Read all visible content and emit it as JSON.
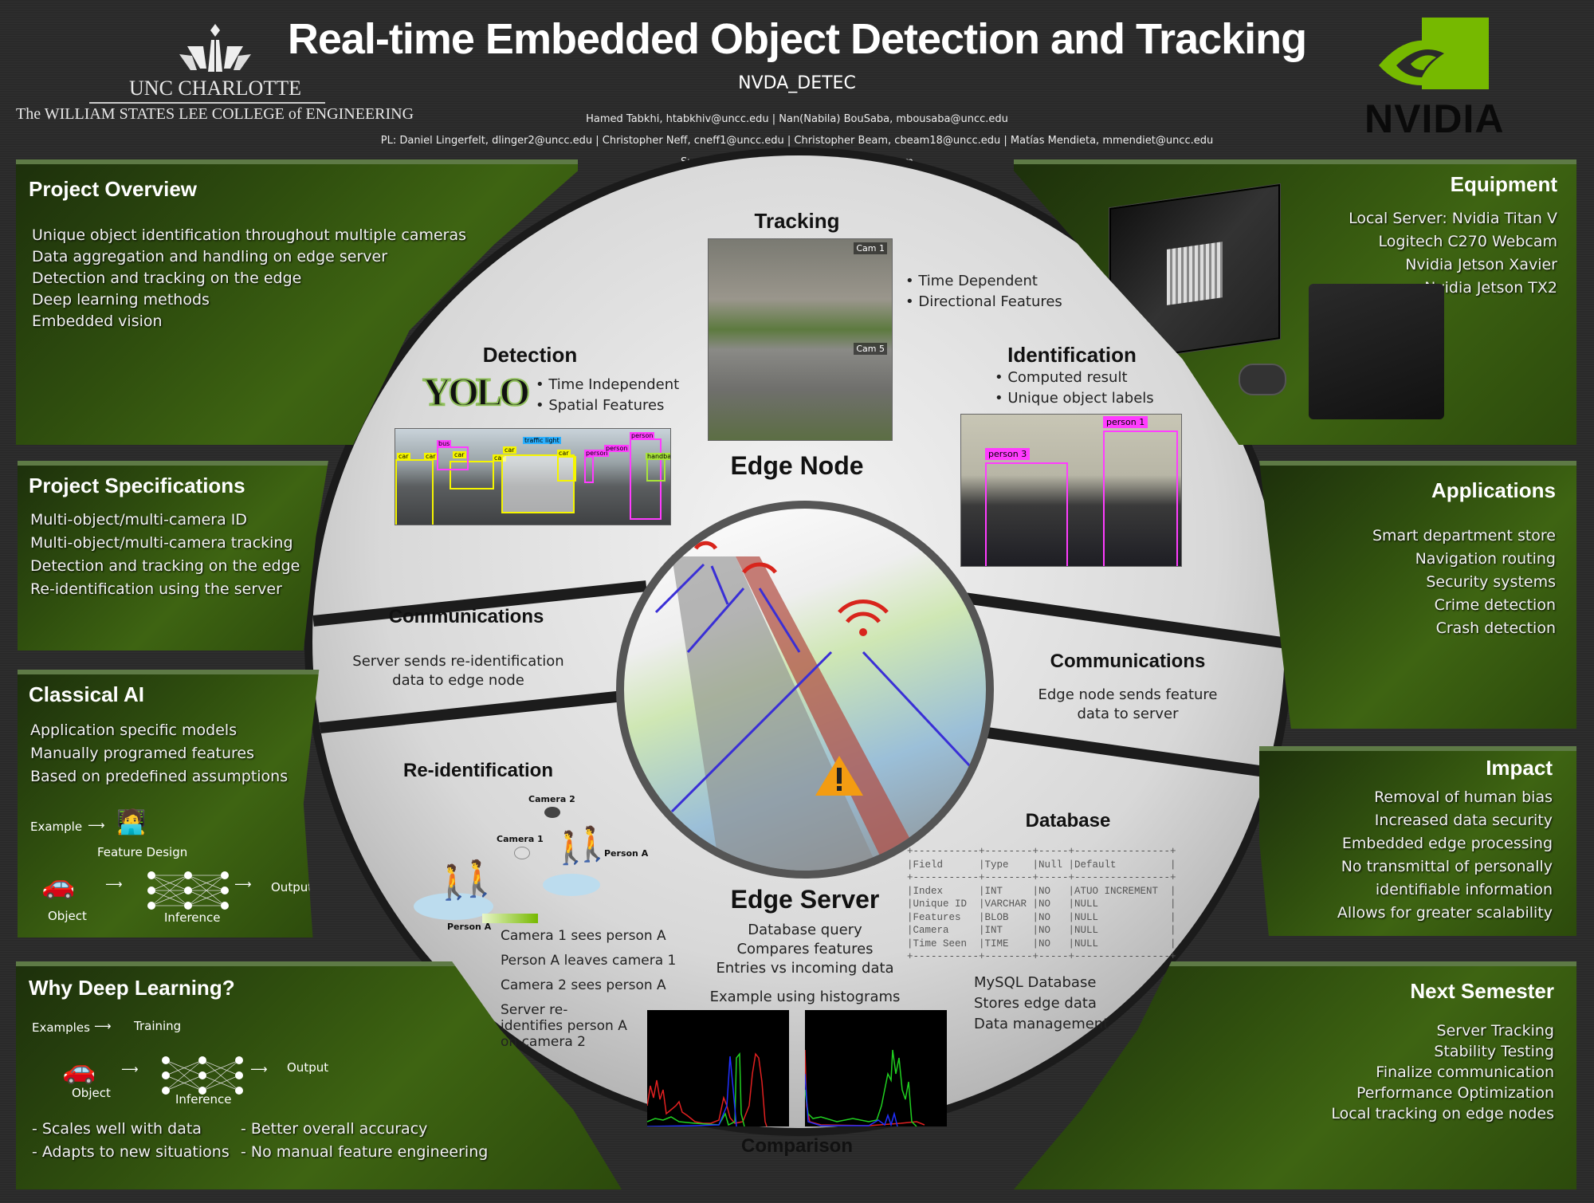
{
  "header": {
    "title": "Real-time Embedded Object Detection and Tracking",
    "subtitle": "NVDA_DETEC",
    "authors_line1": "Hamed Tabkhi, htabkhiv@uncc.edu | Nan(Nabila) BouSaba, mbousaba@uncc.edu",
    "authors_line2": "PL: Daniel Lingerfelt, dlinger2@uncc.edu | Christopher Neff, cneff1@uncc.edu | Christopher Beam, cbeam18@uncc.edu | Matías Mendieta, mmendiet@uncc.edu",
    "supporter": "Supporter: Rob Murray, rmurray@nvidia.com",
    "university": "UNC CHARLOTTE",
    "college": "The WILLIAM STATES LEE COLLEGE of ENGINEERING",
    "sponsor_logo": "NVIDIA"
  },
  "left_panels": {
    "overview": {
      "title": "Project Overview",
      "items": [
        "Unique object identification throughout multiple cameras",
        "Data aggregation and handling on edge server",
        "Detection and tracking on the edge",
        "Deep learning methods",
        "Embedded vision"
      ]
    },
    "specs": {
      "title": "Project Specifications",
      "items": [
        "Multi-object/multi-camera ID",
        "Multi-object/multi-camera tracking",
        "Detection and tracking on the edge",
        "Re-identification using the server"
      ]
    },
    "classical": {
      "title": "Classical AI",
      "items": [
        "Application specific models",
        "Manually programed features",
        "Based on predefined assumptions"
      ],
      "diagram": {
        "example": "Example",
        "feature_design": "Feature Design",
        "object": "Object",
        "inference": "Inference",
        "output": "Output"
      }
    },
    "deep": {
      "title": "Why Deep Learning?",
      "diagram": {
        "examples": "Examples",
        "training": "Training",
        "object": "Object",
        "inference": "Inference",
        "output": "Output"
      },
      "pros_left": [
        "- Scales well with data",
        "- Adapts to new situations"
      ],
      "pros_right": [
        "- Better overall accuracy",
        "- No manual feature engineering"
      ]
    }
  },
  "right_panels": {
    "equipment": {
      "title": "Equipment",
      "items": [
        "Local Server: Nvidia Titan V",
        "Logitech C270 Webcam",
        "Nvidia Jetson Xavier",
        "Nvidia Jetson TX2"
      ]
    },
    "applications": {
      "title": "Applications",
      "items": [
        "Smart department  store",
        "Navigation routing",
        "Security systems",
        "Crime detection",
        "Crash detection"
      ]
    },
    "impact": {
      "title": "Impact",
      "items": [
        "Removal of human bias",
        "Increased data security",
        "Embedded edge processing",
        "No transmittal of personally",
        "identifiable information",
        "Allows for greater scalability"
      ]
    },
    "next": {
      "title": "Next Semester",
      "items": [
        "Server Tracking",
        "Stability Testing",
        "Finalize communication",
        "Performance Optimization",
        "Local tracking on edge nodes"
      ]
    }
  },
  "center": {
    "tracking": {
      "title": "Tracking",
      "bullets": [
        "Time Dependent",
        "Directional Features"
      ],
      "cam_labels": [
        "Cam 1",
        "Cam 5"
      ]
    },
    "detection": {
      "title": "Detection",
      "logo": "YOLO",
      "bullets": [
        "Time Independent",
        "Spatial Features"
      ],
      "box_labels": [
        "car",
        "car",
        "bus",
        "car",
        "car",
        "car",
        "traffic light",
        "car",
        "person",
        "person",
        "person",
        "handbag"
      ]
    },
    "identification": {
      "title": "Identification",
      "bullets": [
        "Computed result",
        "Unique object labels"
      ],
      "box_labels": [
        "person 3",
        "person 1"
      ]
    },
    "edge_node": {
      "title": "Edge Node"
    },
    "comm_left": {
      "title": "Communications",
      "text": "Server sends re-identification data to edge node"
    },
    "comm_right": {
      "title": "Communications",
      "text": "Edge node sends feature data to server"
    },
    "reid": {
      "title": "Re-identification",
      "labels": {
        "camera2": "Camera 2",
        "camera1": "Camera 1",
        "person_a_top": "Person A",
        "person_a_bottom": "Person A"
      },
      "steps": [
        "Camera 1 sees person A",
        "Person A leaves camera 1",
        "Camera 2 sees person A",
        "Server re-identifies person A on camera 2"
      ]
    },
    "edge_server": {
      "title": "Edge Server",
      "items": [
        "Database query",
        "Compares features",
        "Entries vs incoming data"
      ],
      "hist_caption": "Example using histograms",
      "comparison": "Comparison"
    },
    "database": {
      "title": "Database",
      "columns": [
        "Field",
        "Type",
        "Null",
        "Default"
      ],
      "rows": [
        [
          "Index",
          "INT",
          "NO",
          "ATUO INCREMENT"
        ],
        [
          "Unique ID",
          "VARCHAR",
          "NO",
          "NULL"
        ],
        [
          "Features",
          "BLOB",
          "NO",
          "NULL"
        ],
        [
          "Camera",
          "INT",
          "NO",
          "NULL"
        ],
        [
          "Time Seen",
          "TIME",
          "NO",
          "NULL"
        ]
      ],
      "notes": [
        "MySQL Database",
        "Stores edge data",
        "Data management"
      ]
    }
  },
  "colors": {
    "panel_green": "#3e6412",
    "nvidia_green": "#76b900",
    "background": "#2a2a2a",
    "detect_yellow": "#f5f500",
    "detect_magenta": "#ff3cff"
  }
}
